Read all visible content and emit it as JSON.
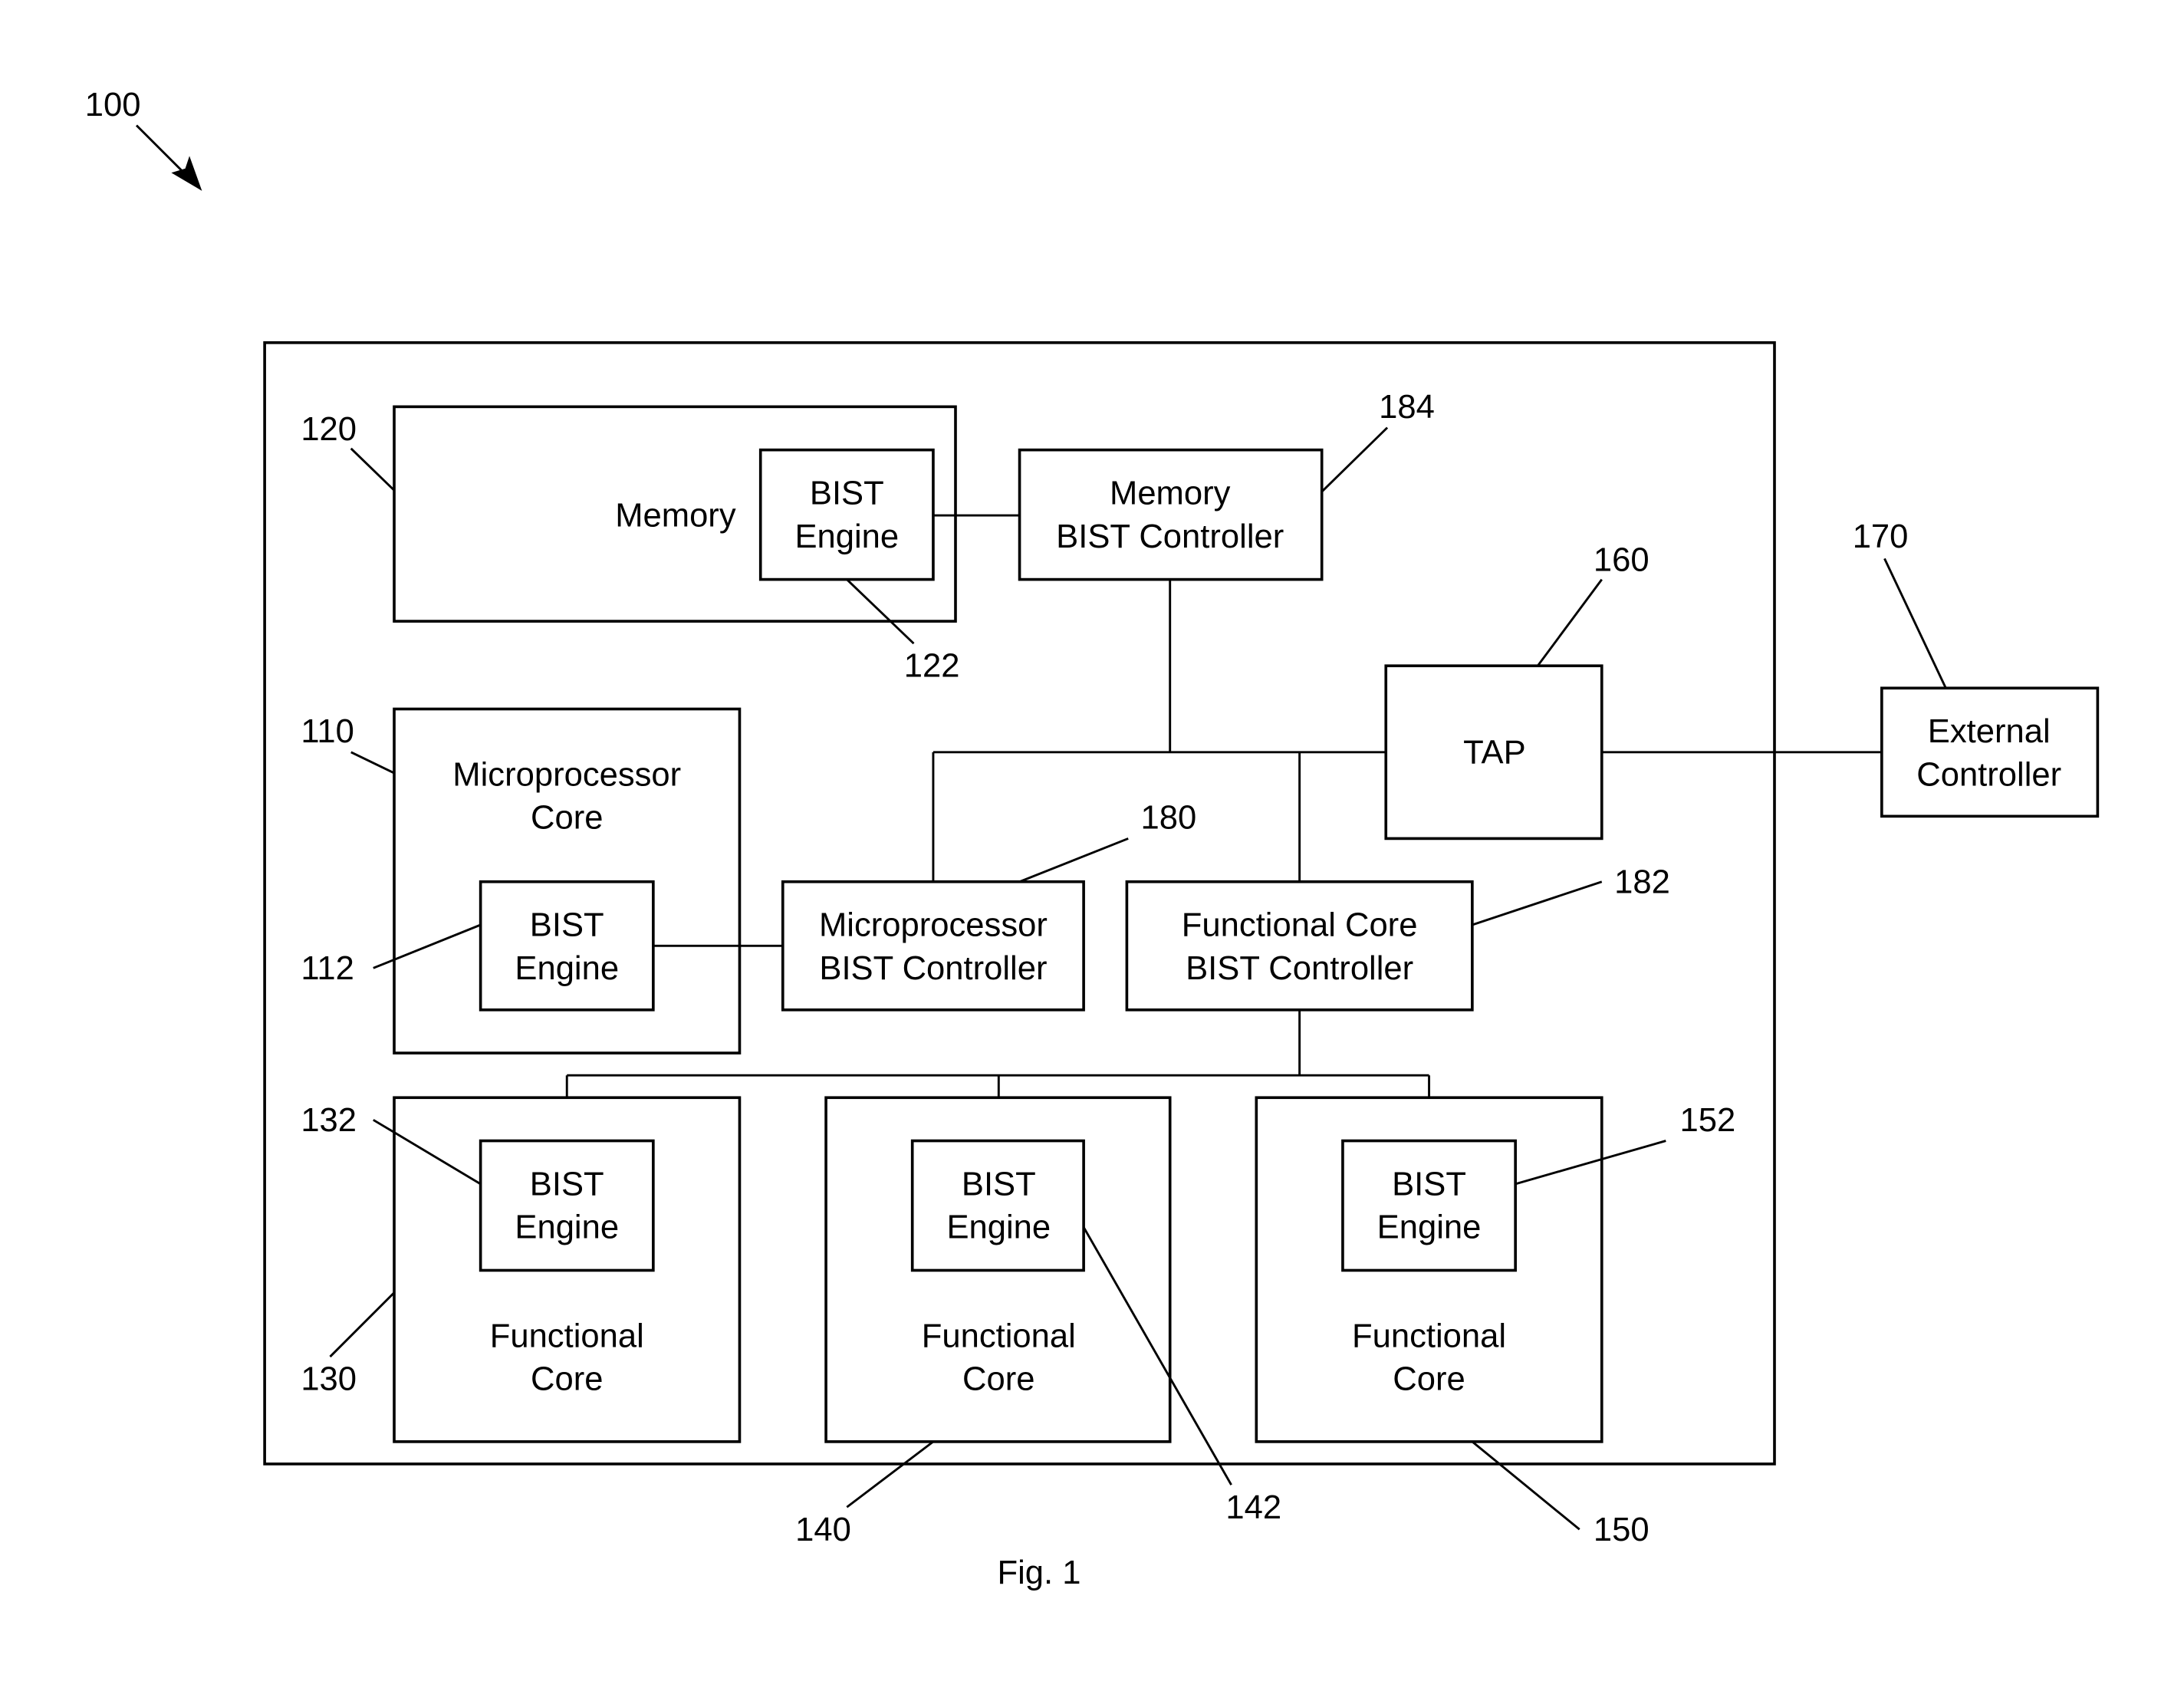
{
  "figure": {
    "ref_overall": "100",
    "caption": "Fig. 1",
    "colors": {
      "stroke": "#000000",
      "background": "#ffffff"
    }
  },
  "blocks": {
    "memory": {
      "ref": "120",
      "label": "Memory"
    },
    "memory_bist_engine": {
      "ref": "122",
      "lines": [
        "BIST",
        "Engine"
      ]
    },
    "memory_bist_controller": {
      "ref": "184",
      "lines": [
        "Memory",
        "BIST Controller"
      ]
    },
    "tap": {
      "ref": "160",
      "label": "TAP"
    },
    "external_controller": {
      "ref": "170",
      "lines": [
        "External",
        "Controller"
      ]
    },
    "microprocessor_core": {
      "ref": "110",
      "lines": [
        "Microprocessor",
        "Core"
      ]
    },
    "microprocessor_bist_engine": {
      "ref": "112",
      "lines": [
        "BIST",
        "Engine"
      ]
    },
    "microprocessor_bist_controller": {
      "ref": "180",
      "lines": [
        "Microprocessor",
        "BIST Controller"
      ]
    },
    "functional_core_bist_controller": {
      "ref": "182",
      "lines": [
        "Functional Core",
        "BIST Controller"
      ]
    },
    "functional_core_1": {
      "ref": "130",
      "lines": [
        "Functional",
        "Core"
      ]
    },
    "functional_core_1_bist_engine": {
      "ref": "132",
      "lines": [
        "BIST",
        "Engine"
      ]
    },
    "functional_core_2": {
      "ref": "140",
      "lines": [
        "Functional",
        "Core"
      ]
    },
    "functional_core_2_bist_engine": {
      "ref": "142",
      "lines": [
        "BIST",
        "Engine"
      ]
    },
    "functional_core_3": {
      "ref": "150",
      "lines": [
        "Functional",
        "Core"
      ]
    },
    "functional_core_3_bist_engine": {
      "ref": "152",
      "lines": [
        "BIST",
        "Engine"
      ]
    }
  }
}
